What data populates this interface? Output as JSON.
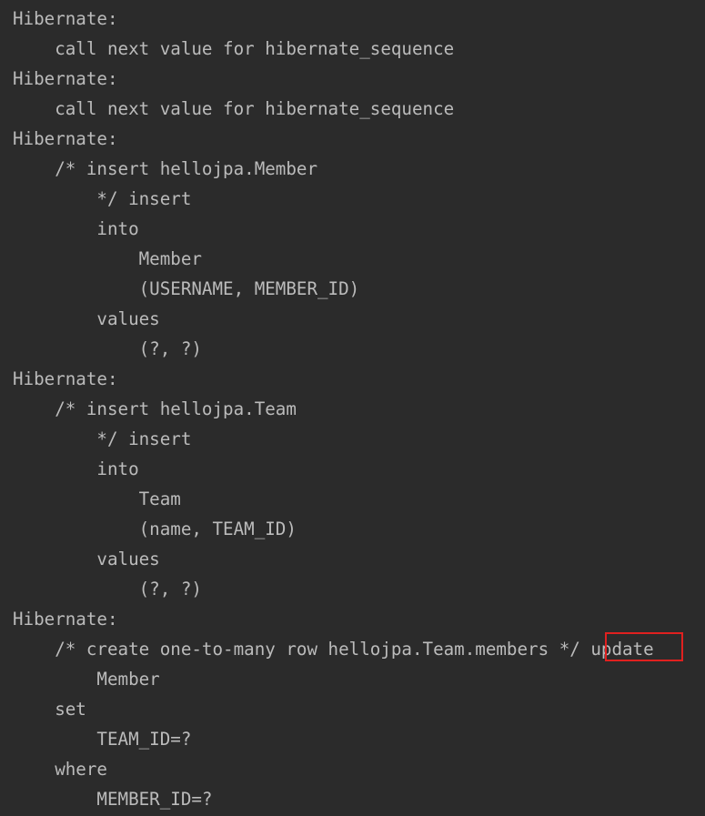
{
  "lines": [
    "Hibernate:",
    "    call next value for hibernate_sequence",
    "Hibernate:",
    "    call next value for hibernate_sequence",
    "Hibernate:",
    "    /* insert hellojpa.Member",
    "        */ insert",
    "        into",
    "            Member",
    "            (USERNAME, MEMBER_ID)",
    "        values",
    "            (?, ?)",
    "Hibernate:",
    "    /* insert hellojpa.Team",
    "        */ insert",
    "        into",
    "            Team",
    "            (name, TEAM_ID)",
    "        values",
    "            (?, ?)",
    "Hibernate:",
    "    /* create one-to-many row hellojpa.Team.members */ update",
    "        Member",
    "    set",
    "        TEAM_ID=?",
    "    where",
    "        MEMBER_ID=?"
  ],
  "highlight": {
    "text": "update",
    "color": "#e0201f"
  },
  "colors": {
    "background": "#2b2b2b",
    "text": "#bbbbbb"
  }
}
